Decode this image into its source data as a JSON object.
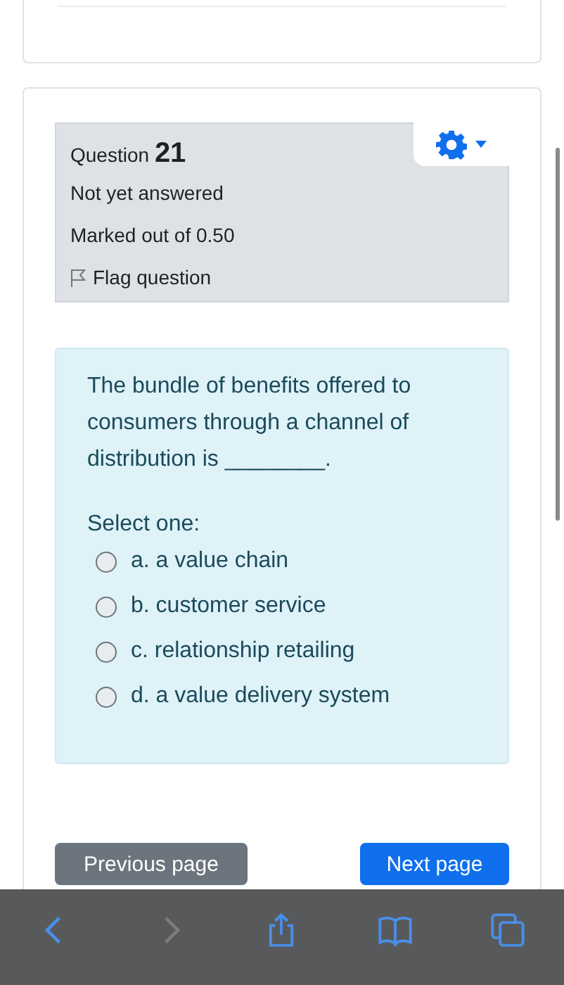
{
  "question": {
    "label": "Question",
    "number": "21",
    "status": "Not yet answered",
    "marks": "Marked out of 0.50",
    "flag": "Flag question"
  },
  "prompt": "The bundle of benefits offered to consumers through a channel of distribution is ________.",
  "select_label": "Select one:",
  "options": [
    {
      "label": "a.  a value chain",
      "selected": false
    },
    {
      "label": "b. customer service",
      "selected": false
    },
    {
      "label": "c. relationship retailing",
      "selected": false
    },
    {
      "label": "d. a value delivery system",
      "selected": false
    }
  ],
  "navigation": [
    {
      "label": "Previous page",
      "kind": "secondary"
    },
    {
      "label": "Next page",
      "kind": "primary"
    }
  ],
  "browser_toolbar": [
    {
      "kind": "back",
      "disabled": false
    },
    {
      "kind": "forward",
      "disabled": true
    },
    {
      "kind": "share",
      "disabled": false
    },
    {
      "kind": "bookmarks",
      "disabled": false
    },
    {
      "kind": "tabs",
      "disabled": false
    }
  ]
}
